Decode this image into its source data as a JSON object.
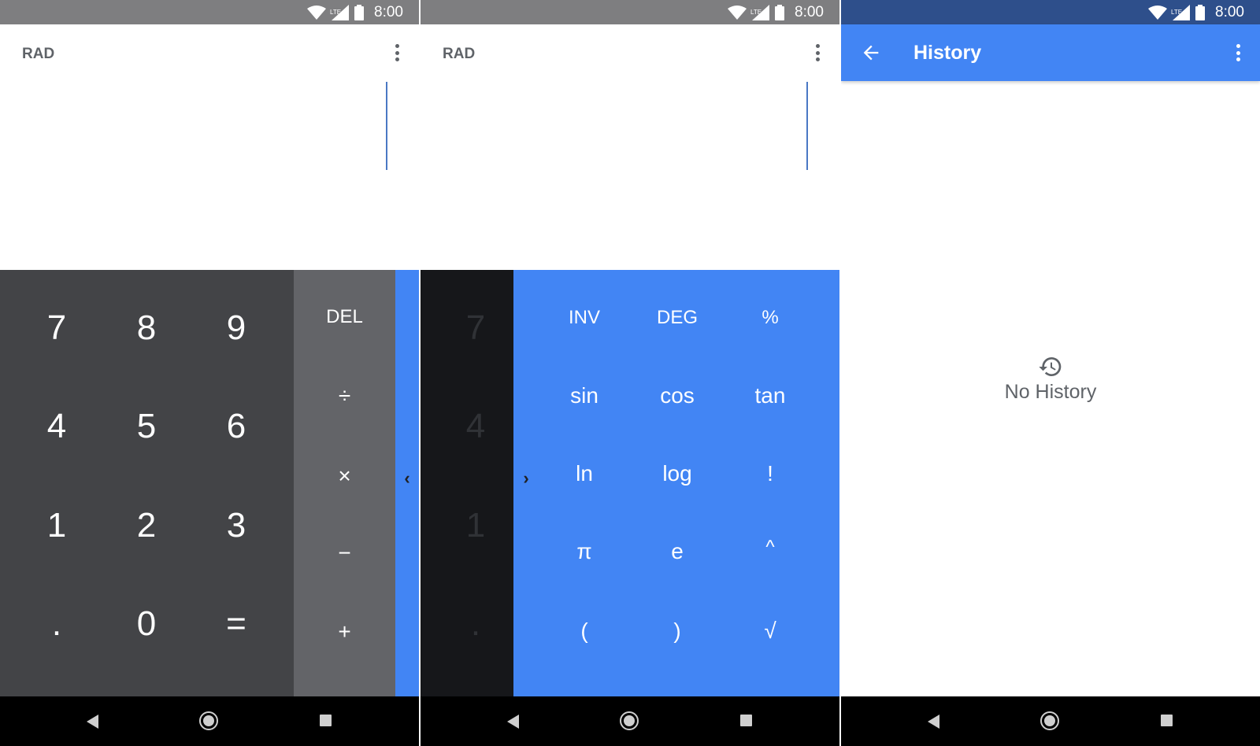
{
  "status": {
    "time": "8:00",
    "network": "LTE"
  },
  "calc": {
    "mode": "RAD",
    "numpad": [
      "7",
      "8",
      "9",
      "4",
      "5",
      "6",
      "1",
      "2",
      "3",
      ".",
      "0",
      "="
    ],
    "ops": [
      "DEL",
      "÷",
      "×",
      "−",
      "+"
    ],
    "advanced": [
      "INV",
      "DEG",
      "%",
      "sin",
      "cos",
      "tan",
      "ln",
      "log",
      "!",
      "π",
      "e",
      "^",
      "(",
      ")",
      "√"
    ],
    "partial_numpad": [
      "7",
      "4",
      "1",
      "."
    ]
  },
  "history": {
    "title": "History",
    "empty_text": "No History"
  },
  "colors": {
    "accent": "#4285f4",
    "numpad": "#434447",
    "ops": "#636468",
    "status_history": "#2e4f8b"
  },
  "icons": [
    "wifi-icon",
    "signal-icon",
    "battery-icon",
    "more-vert-icon",
    "chevron-left-icon",
    "chevron-right-icon",
    "arrow-back-icon",
    "history-icon",
    "nav-back-icon",
    "nav-home-icon",
    "nav-recent-icon"
  ]
}
